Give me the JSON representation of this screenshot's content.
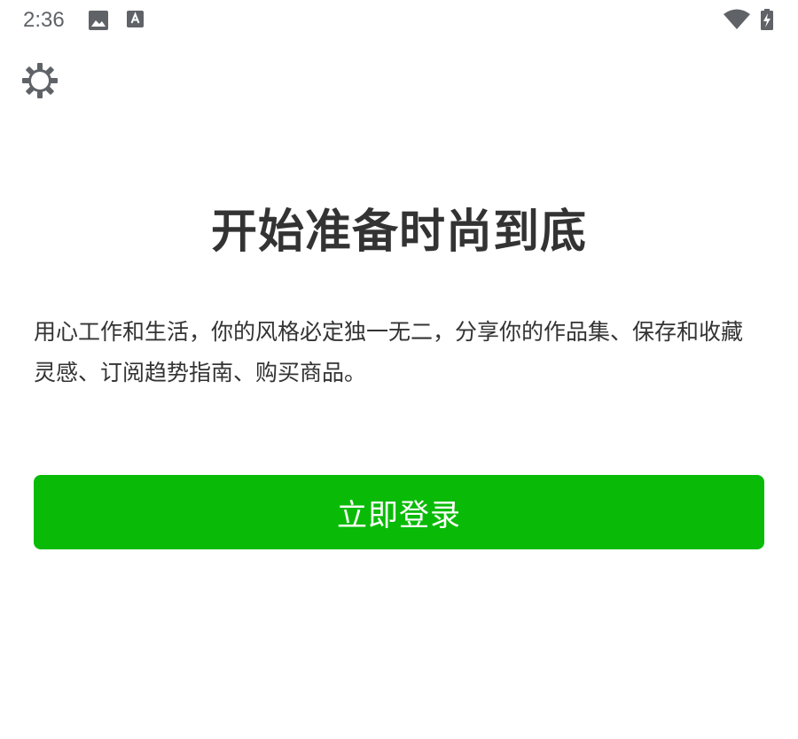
{
  "status_bar": {
    "time": "2:36",
    "icons": [
      "image-icon",
      "font-icon",
      "wifi-icon",
      "battery-charging-icon"
    ]
  },
  "header": {
    "settings_icon": "gear-icon"
  },
  "hero": {
    "title": "开始准备时尚到底",
    "description": "用心工作和生活，你的风格必定独一无二，分享你的作品集、保存和收藏灵感、订阅趋势指南、购买商品。"
  },
  "actions": {
    "login_label": "立即登录"
  },
  "colors": {
    "accent": "#09bb07",
    "text": "#333333",
    "status_icon": "#5f6368"
  }
}
